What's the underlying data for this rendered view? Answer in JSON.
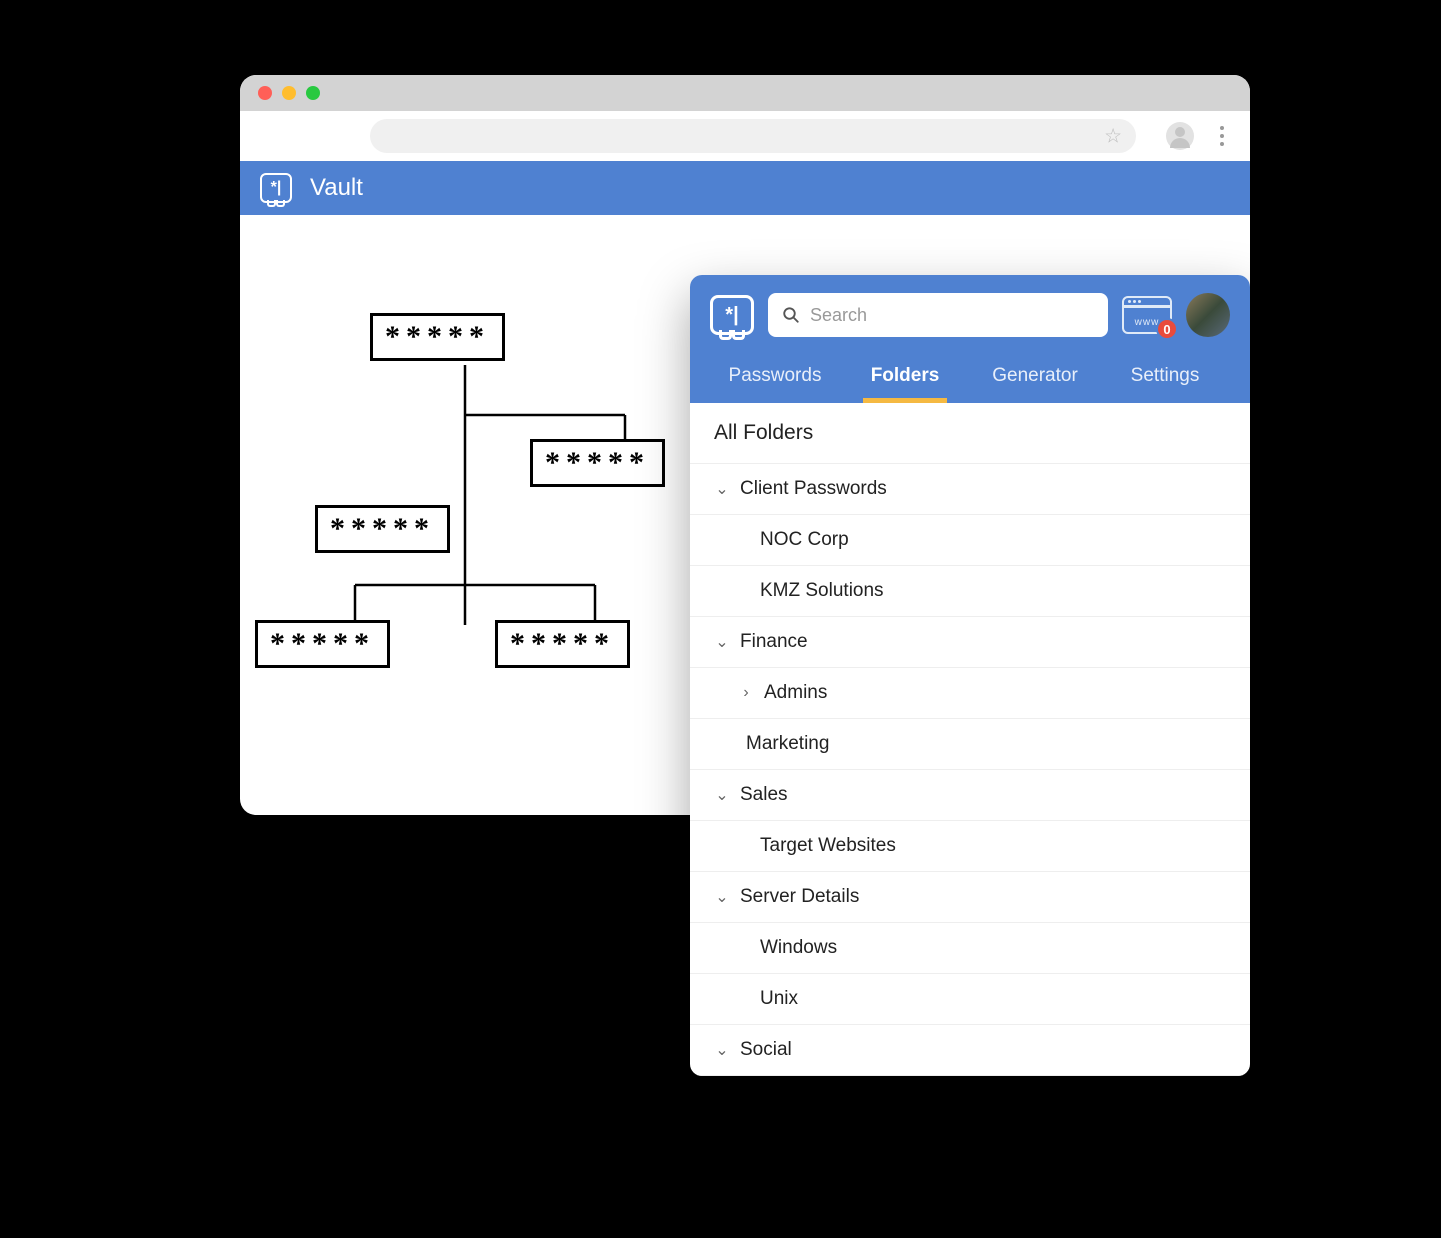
{
  "browser": {
    "app_title": "Vault",
    "logo_glyph": "*|"
  },
  "tree": {
    "nodes": [
      "*****",
      "*****",
      "*****",
      "*****",
      "*****"
    ]
  },
  "extension": {
    "logo_glyph": "*|",
    "search_placeholder": "Search",
    "badge_count": "0",
    "www_label": "www",
    "tabs": [
      {
        "label": "Passwords",
        "active": false
      },
      {
        "label": "Folders",
        "active": true
      },
      {
        "label": "Generator",
        "active": false
      },
      {
        "label": "Settings",
        "active": false
      }
    ],
    "section_title": "All Folders",
    "folders": [
      {
        "type": "parent",
        "label": "Client Passwords",
        "icon": "down"
      },
      {
        "type": "child",
        "label": "NOC Corp"
      },
      {
        "type": "child",
        "label": "KMZ Solutions"
      },
      {
        "type": "parent",
        "label": "Finance",
        "icon": "down"
      },
      {
        "type": "child-collapsed",
        "label": "Admins",
        "icon": "right"
      },
      {
        "type": "plain",
        "label": "Marketing"
      },
      {
        "type": "parent",
        "label": "Sales",
        "icon": "down"
      },
      {
        "type": "child",
        "label": "Target Websites"
      },
      {
        "type": "parent",
        "label": "Server Details",
        "icon": "down"
      },
      {
        "type": "child",
        "label": "Windows"
      },
      {
        "type": "child",
        "label": "Unix"
      },
      {
        "type": "parent",
        "label": "Social",
        "icon": "down"
      }
    ]
  }
}
